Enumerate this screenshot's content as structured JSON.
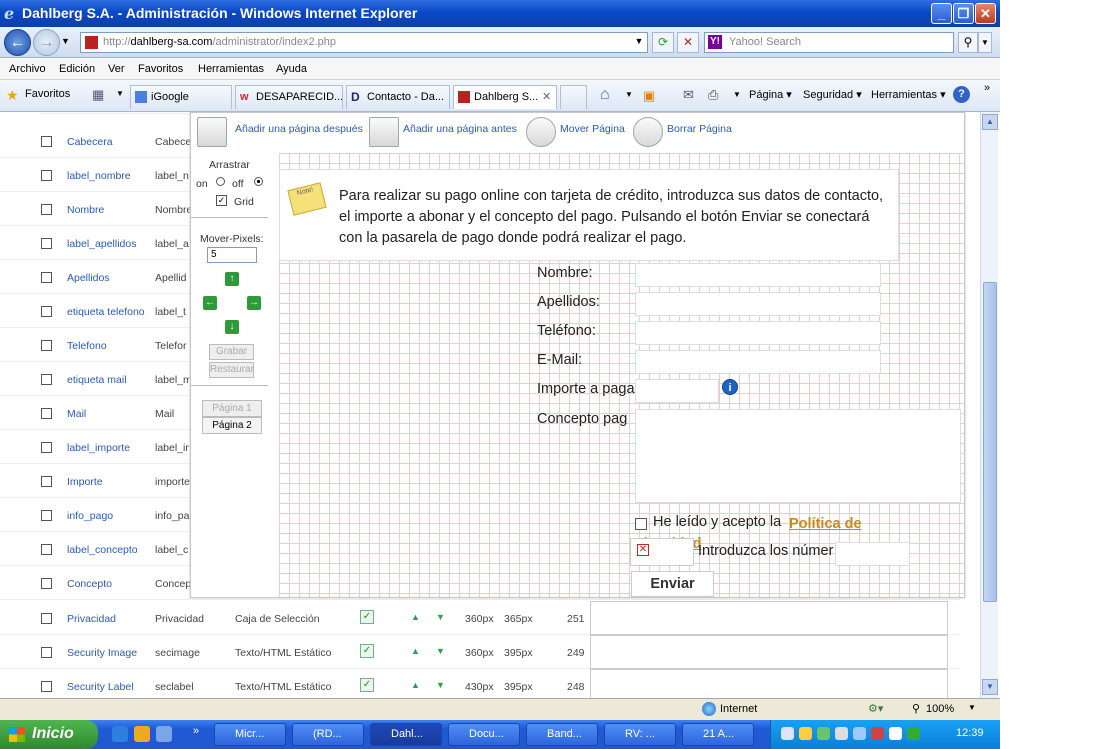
{
  "window": {
    "title": "Dahlberg S.A. - Administración - Windows Internet Explorer",
    "min": "_",
    "max": "❐",
    "close": "✕"
  },
  "address": {
    "prefix": "http://",
    "domain": "dahlberg-sa.com",
    "path": "/administrator/index2.php",
    "search_placeholder": "Yahoo! Search",
    "yahoo_badge": "Y!"
  },
  "menu": [
    "Archivo",
    "Edición",
    "Ver",
    "Favoritos",
    "Herramientas",
    "Ayuda"
  ],
  "favorites": {
    "label": "Favoritos",
    "tabs": [
      "iGoogle",
      "DESAPARECID...",
      "Contacto - Da...",
      "Dahlberg S..."
    ],
    "commands": [
      "Página ▾",
      "Seguridad ▾",
      "Herramientas ▾"
    ]
  },
  "editor": {
    "toolbar": [
      "Añadir una página después",
      "Añadir una página antes",
      "Mover Página",
      "Borrar Página"
    ],
    "side": {
      "drag": "Arrastrar",
      "on": "on",
      "off": "off",
      "grid": "Grid",
      "mover_pixels": "Mover-Pixels:",
      "pixels_value": "5",
      "save": "Grabar",
      "restore": "Restaurar",
      "page1": "Página 1",
      "page2": "Página 2"
    },
    "notice": "Para realizar su pago online con tarjeta de crédito, introduzca sus datos de contacto, el importe a abonar y el concepto del pago. Pulsando el botón Enviar se conectará con la pasarela de pago donde podrá realizar el pago.",
    "note_icon_text": "Note!",
    "form": {
      "nombre": "Nombre:",
      "apellidos": "Apellidos:",
      "telefono": "Teléfono:",
      "email": "E-Mail:",
      "importe": "Importe a paga",
      "concepto": "Concepto pag",
      "privacy_prefix": "He leído y acepto la",
      "privacy_link": "Política de privacidad",
      "captcha": "Introduzca los númer",
      "send": "Enviar"
    }
  },
  "rows": [
    {
      "label": "Cabecera",
      "name": "Cabece",
      "type": "",
      "px1": "",
      "px2": "",
      "num": ""
    },
    {
      "label": "label_nombre",
      "name": "label_n",
      "type": "",
      "px1": "",
      "px2": "",
      "num": ""
    },
    {
      "label": "Nombre",
      "name": "Nombre",
      "type": "",
      "px1": "",
      "px2": "",
      "num": ""
    },
    {
      "label": "label_apellidos",
      "name": "label_a",
      "type": "",
      "px1": "",
      "px2": "",
      "num": ""
    },
    {
      "label": "Apellidos",
      "name": "Apellid",
      "type": "",
      "px1": "",
      "px2": "",
      "num": ""
    },
    {
      "label": "etiqueta telefono",
      "name": "label_t",
      "type": "",
      "px1": "",
      "px2": "",
      "num": ""
    },
    {
      "label": "Telefono",
      "name": "Telefor",
      "type": "",
      "px1": "",
      "px2": "",
      "num": ""
    },
    {
      "label": "etiqueta mail",
      "name": "label_m",
      "type": "",
      "px1": "",
      "px2": "",
      "num": ""
    },
    {
      "label": "Mail",
      "name": "Mail",
      "type": "",
      "px1": "",
      "px2": "",
      "num": ""
    },
    {
      "label": "label_importe",
      "name": "label_ir",
      "type": "",
      "px1": "",
      "px2": "",
      "num": ""
    },
    {
      "label": "Importe",
      "name": "importe",
      "type": "",
      "px1": "",
      "px2": "",
      "num": ""
    },
    {
      "label": "info_pago",
      "name": "info_pa",
      "type": "",
      "px1": "",
      "px2": "",
      "num": ""
    },
    {
      "label": "label_concepto",
      "name": "label_c",
      "type": "",
      "px1": "",
      "px2": "",
      "num": ""
    },
    {
      "label": "Concepto",
      "name": "Concep",
      "type": "",
      "px1": "",
      "px2": "",
      "num": ""
    },
    {
      "label": "Privacidad",
      "name": "Privacidad",
      "type": "Caja de Selección",
      "px1": "360px",
      "px2": "365px",
      "num": "251"
    },
    {
      "label": "Security Image",
      "name": "secimage",
      "type": "Texto/HTML Estático",
      "px1": "360px",
      "px2": "395px",
      "num": "249"
    },
    {
      "label": "Security Label",
      "name": "seclabel",
      "type": "Texto/HTML Estático",
      "px1": "430px",
      "px2": "395px",
      "num": "248"
    }
  ],
  "status": {
    "zone": "Internet",
    "zoom": "100%"
  },
  "taskbar": {
    "start": "Inicio",
    "tasks": [
      "Micr...",
      "(RD...",
      "Dahl...",
      "Docu...",
      "Band...",
      "RV: ...",
      "21 A..."
    ],
    "clock": "12:39"
  }
}
